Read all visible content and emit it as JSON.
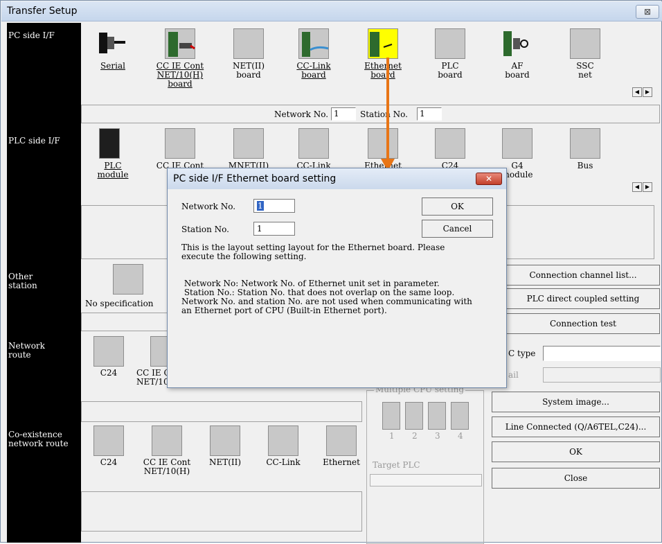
{
  "window": {
    "title": "Transfer Setup",
    "close_label": "⊠"
  },
  "left_labels": {
    "pc_side": "PC side I/F",
    "plc_side": "PLC side I/F",
    "other_station": "Other\nstation",
    "network_route": "Network\nroute",
    "coexistence": "Co-existence\nnetwork route"
  },
  "pc_side": {
    "items": [
      {
        "label": "Serial"
      },
      {
        "label": "CC IE Cont\nNET/10(H)\nboard"
      },
      {
        "label": "NET(II)\nboard"
      },
      {
        "label": "CC-Link\nboard"
      },
      {
        "label": "Ethernet\nboard"
      },
      {
        "label": "PLC\nboard"
      },
      {
        "label": "AF\nboard"
      },
      {
        "label": "SSC\nnet"
      }
    ],
    "network_no_label": "Network No.",
    "network_no_value": "1",
    "station_no_label": "Station No.",
    "station_no_value": "1"
  },
  "plc_side": {
    "items": [
      {
        "label": "PLC\nmodule"
      },
      {
        "label": "CC IE Cont"
      },
      {
        "label": "MNET(II)"
      },
      {
        "label": "CC-Link"
      },
      {
        "label": "Ethernet"
      },
      {
        "label": "C24"
      },
      {
        "label": "G4\nmodule"
      },
      {
        "label": "Bus"
      }
    ]
  },
  "other_station": {
    "no_spec_label": "No specification"
  },
  "network_route": {
    "items": [
      {
        "label": "C24"
      },
      {
        "label": "CC IE Cont\nNET/10(H)"
      }
    ]
  },
  "coexistence": {
    "items": [
      {
        "label": "C24"
      },
      {
        "label": "CC IE Cont\nNET/10(H)"
      },
      {
        "label": "NET(II)"
      },
      {
        "label": "CC-Link"
      },
      {
        "label": "Ethernet"
      }
    ]
  },
  "right_buttons": {
    "connection_channel": "Connection channel list...",
    "plc_direct": "PLC direct coupled setting",
    "connection_test": "Connection test",
    "system_image": "System  image...",
    "line_connected": "Line Connected (Q/A6TEL,C24)...",
    "ok": "OK",
    "close": "Close"
  },
  "right_fields": {
    "plc_type_label": "C type",
    "detail_label": "ail"
  },
  "multi_cpu": {
    "title": "Multiple CPU setting",
    "numbers": [
      "1",
      "2",
      "3",
      "4"
    ],
    "target_label": "Target PLC"
  },
  "dialog": {
    "title": "PC side I/F  Ethernet board setting",
    "close_label": "✕",
    "network_no_label": "Network No.",
    "network_no_value": "1",
    "station_no_label": "Station No.",
    "station_no_value": "1",
    "ok": "OK",
    "cancel": "Cancel",
    "desc1": "This is the layout setting layout for the Ethernet board. Please\nexecute the following setting.",
    "desc2": " Network No: Network No. of Ethernet unit set in parameter.\n Station No.: Station No. that does not overlap on the same loop.\nNetwork No. and station No. are not used when communicating with\nan Ethernet port of CPU (Built-in Ethernet port)."
  },
  "colors": {
    "arrow": "#e87516",
    "highlight_icon": "#ffff00"
  }
}
